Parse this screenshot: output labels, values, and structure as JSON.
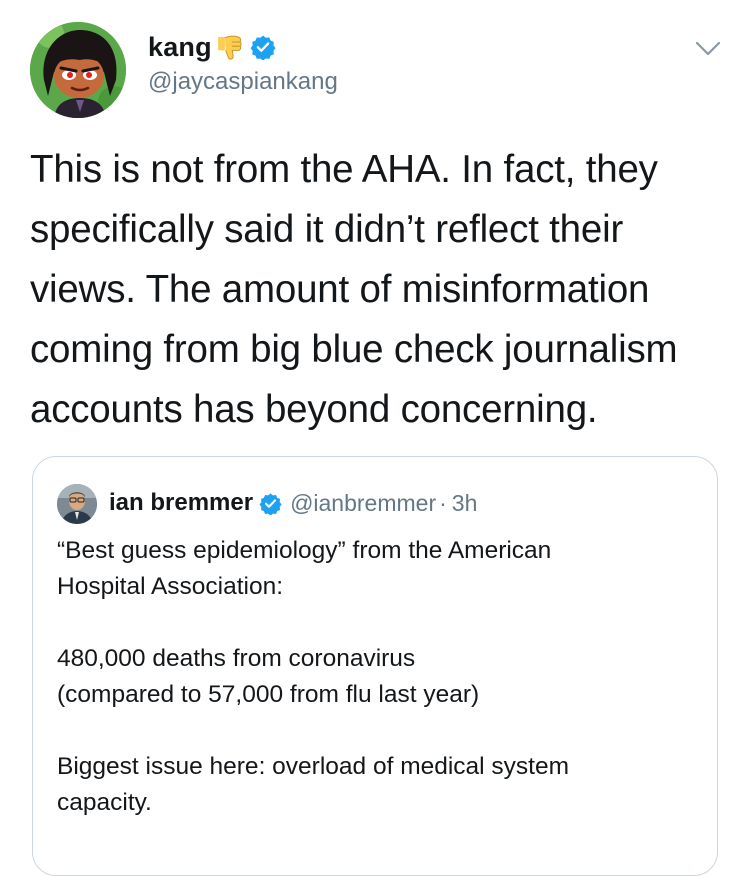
{
  "author": {
    "display_name": "kang",
    "name_emoji": "thumbs-down-emoji",
    "verified": true,
    "handle": "@jaycaspiankang"
  },
  "tweet": {
    "text": "This is not from the AHA. In fact, they\nspecifically said it didn’t reflect their\nviews. The amount of misinformation\ncoming from big blue check journalism\naccounts has beyond concerning."
  },
  "quoted_tweet": {
    "display_name": "ian bremmer",
    "verified": true,
    "handle": "@ianbremmer",
    "separator": "·",
    "time": "3h",
    "paragraphs": [
      [
        "“Best guess epidemiology” from the American",
        "Hospital Association:"
      ],
      [
        "480,000 deaths from coronavirus",
        "(compared to 57,000 from flu last year)"
      ],
      [
        "Biggest issue here: overload of medical system",
        "capacity."
      ]
    ]
  },
  "colors": {
    "text_primary": "#14171a",
    "text_secondary": "#657786",
    "verified_blue": "#1da1f2",
    "border": "#ccd6dd",
    "emoji_yellow": "#ffcc4d"
  }
}
